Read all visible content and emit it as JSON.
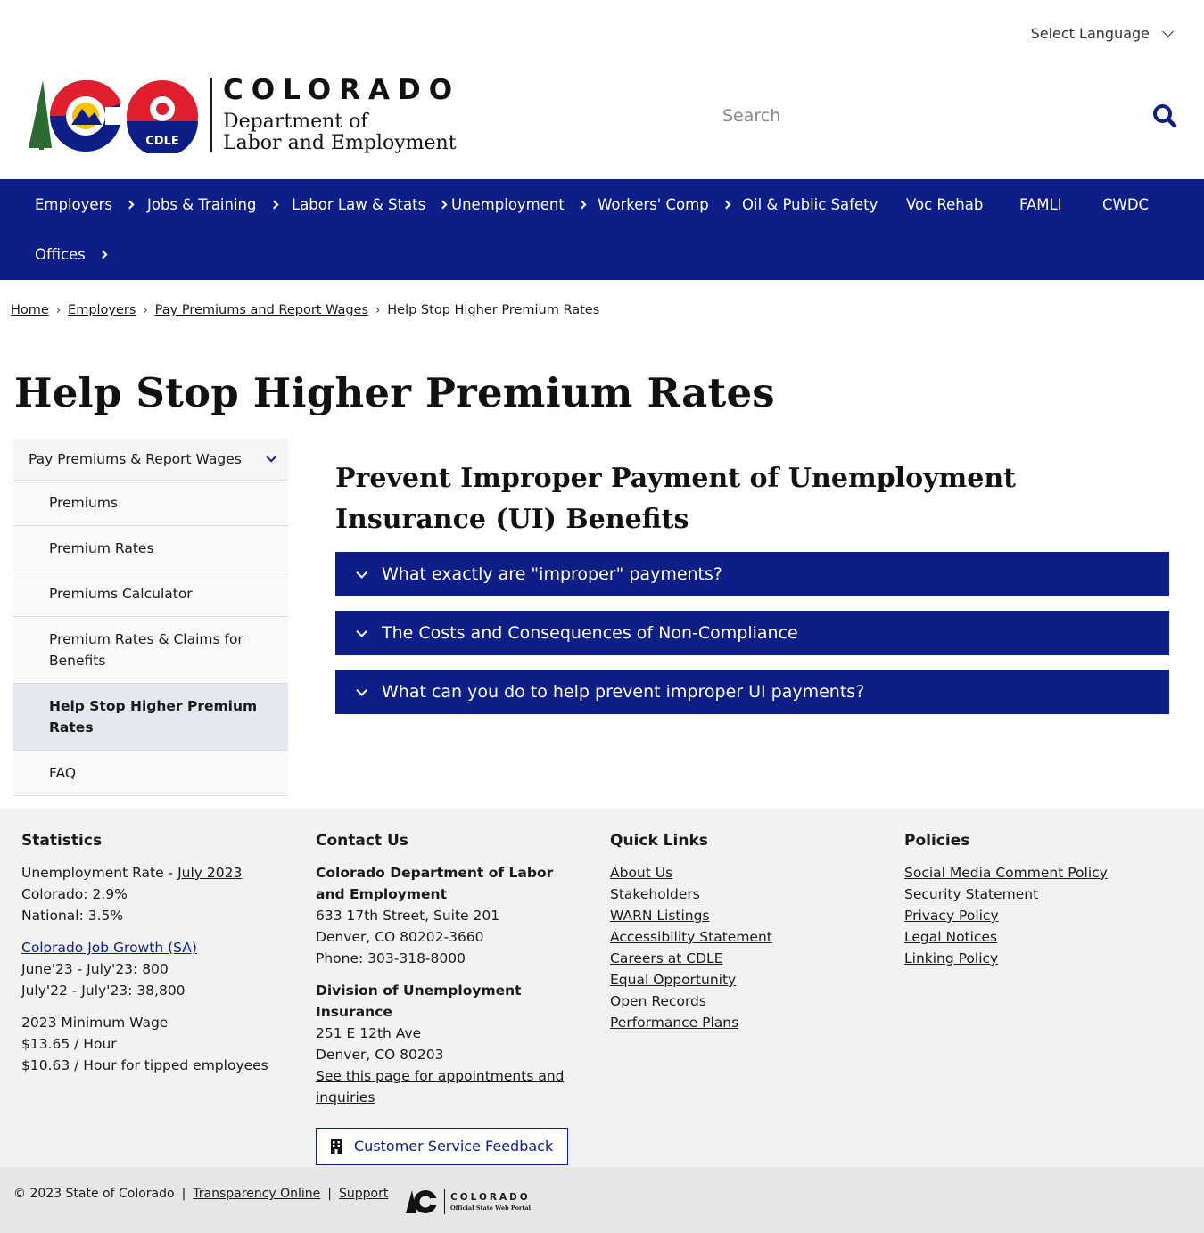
{
  "language": {
    "label": "Select Language"
  },
  "header": {
    "logo_state": "COLORADO",
    "logo_dept_line1": "Department of",
    "logo_dept_line2": "Labor and Employment",
    "logo_badge": "CDLE",
    "search_placeholder": "Search"
  },
  "nav": {
    "items": [
      {
        "label": "Employers",
        "has_arrow": true
      },
      {
        "label": "Jobs & Training",
        "has_arrow": true
      },
      {
        "label": "Labor Law & Stats",
        "has_arrow": true
      },
      {
        "label": "Unemployment",
        "has_arrow": true
      },
      {
        "label": "Workers' Comp",
        "has_arrow": true
      },
      {
        "label": "Oil & Public Safety",
        "has_arrow": false
      },
      {
        "label": "Voc Rehab",
        "has_arrow": false
      },
      {
        "label": "FAMLI",
        "has_arrow": false
      },
      {
        "label": "CWDC",
        "has_arrow": false
      },
      {
        "label": "Offices",
        "has_arrow": true
      }
    ]
  },
  "breadcrumb": [
    "Home",
    "Employers",
    "Pay Premiums and Report Wages",
    "Help Stop Higher Premium Rates"
  ],
  "page_title": "Help Stop Higher Premium Rates",
  "side_menu": {
    "header": "Pay Premiums & Report Wages",
    "items": [
      "Premiums",
      "Premium Rates",
      "Premiums Calculator",
      "Premium Rates & Claims for Benefits",
      "Help Stop Higher Premium Rates",
      "FAQ"
    ],
    "active_index": 4
  },
  "content": {
    "heading": "Prevent Improper Payment of Unemployment Insurance (UI) Benefits",
    "accordions": [
      "What exactly are \"improper\" payments?",
      "The Costs and Consequences of Non-Compliance",
      "What can you do to help prevent improper UI payments?"
    ]
  },
  "footer": {
    "statistics": {
      "title": "Statistics",
      "rate_prefix": "Unemployment Rate - ",
      "rate_link": "July 2023",
      "colorado": "Colorado: 2.9%",
      "national": "National: 3.5%",
      "growth_link": "Colorado Job Growth (SA)",
      "growth_1": "June'23 - July'23: 800",
      "growth_2": "July'22 - July'23: 38,800",
      "wage_title": "2023 Minimum Wage",
      "wage_1": "$13.65 / Hour",
      "wage_2": "$10.63 / Hour for tipped employees"
    },
    "contact": {
      "title": "Contact Us",
      "org": "Colorado Department of Labor and Employment",
      "addr1": "633 17th Street, Suite 201",
      "addr2": "Denver, CO  80202-3660",
      "phone": "Phone: 303-318-8000",
      "div": "Division of Unemployment Insurance",
      "div_addr1": "251 E 12th Ave",
      "div_addr2": "Denver, CO  80203",
      "appt_link": "See this page for appointments and inquiries",
      "feedback_button": "Customer Service Feedback"
    },
    "quick_links": {
      "title": "Quick Links",
      "links": [
        "About Us",
        "Stakeholders",
        "WARN Listings",
        "Accessibility Statement",
        "Careers at CDLE",
        "Equal Opportunity",
        "Open Records",
        "Performance Plans"
      ]
    },
    "policies": {
      "title": "Policies",
      "links": [
        "Social Media Comment Policy",
        "Security Statement",
        "Privacy Policy",
        "Legal Notices",
        "Linking Policy"
      ]
    }
  },
  "subfooter": {
    "copyright": "© 2023 State of Colorado",
    "sep": "|",
    "transparency": "Transparency Online",
    "support": "Support",
    "portal_line1": "COLORADO",
    "portal_line2": "Official State Web Portal"
  },
  "colors": {
    "brand_navy": "#0d1f87",
    "footer_bg": "#f2f2f2",
    "active_menu_bg": "#e4e7ee"
  }
}
